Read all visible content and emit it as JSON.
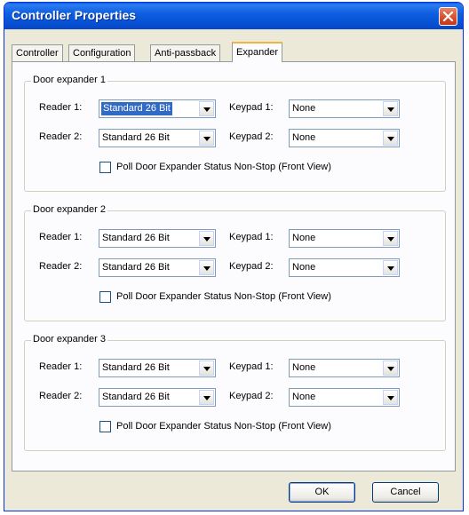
{
  "window": {
    "title": "Controller Properties",
    "colors": {
      "title_bar": "#0754d6",
      "close_button": "#d84a2a",
      "face": "#ece9d8",
      "selection": "#316ac5"
    }
  },
  "tabs": [
    {
      "label": "Controller",
      "active": false
    },
    {
      "label": "Configuration",
      "active": false
    },
    {
      "label": "Anti-passback",
      "active": false
    },
    {
      "label": "Expander",
      "active": true
    }
  ],
  "labels": {
    "reader1": "Reader 1:",
    "reader2": "Reader 2:",
    "keypad1": "Keypad 1:",
    "keypad2": "Keypad 2:",
    "poll": "Poll Door Expander Status Non-Stop (Front View)"
  },
  "groups": [
    {
      "title": "Door expander 1",
      "reader1": "Standard 26 Bit",
      "reader2": "Standard 26 Bit",
      "keypad1": "None",
      "keypad2": "None",
      "poll_checked": false
    },
    {
      "title": "Door expander 2",
      "reader1": "Standard 26 Bit",
      "reader2": "Standard 26 Bit",
      "keypad1": "None",
      "keypad2": "None",
      "poll_checked": false
    },
    {
      "title": "Door expander 3",
      "reader1": "Standard 26 Bit",
      "reader2": "Standard 26 Bit",
      "keypad1": "None",
      "keypad2": "None",
      "poll_checked": false
    }
  ],
  "buttons": {
    "ok": "OK",
    "cancel": "Cancel"
  },
  "icons": {
    "close": "close-icon",
    "dropdown": "chevron-down-icon"
  }
}
